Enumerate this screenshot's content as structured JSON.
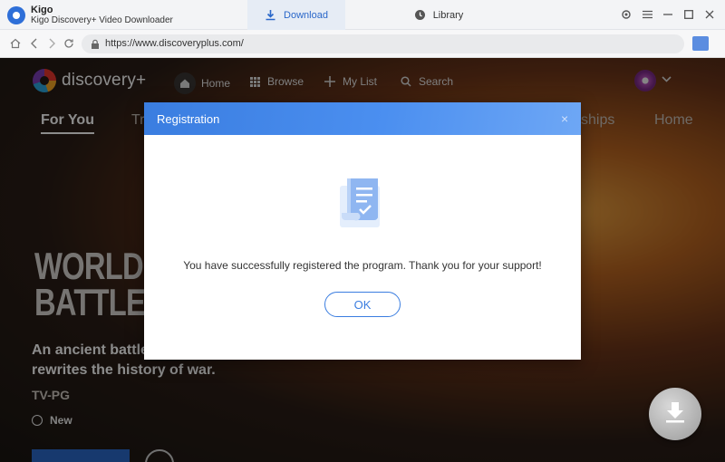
{
  "app": {
    "name": "Kigo",
    "subtitle": "Kigo Discovery+ Video Downloader"
  },
  "tabs": {
    "download": "Download",
    "library": "Library"
  },
  "address": {
    "url": "https://www.discoveryplus.com/"
  },
  "site": {
    "logo_text": "discovery+",
    "nav": {
      "home": "Home",
      "browse": "Browse",
      "mylist": "My List",
      "search": "Search"
    },
    "categories": {
      "for_you": "For You",
      "tr": "Tr",
      "ships": "ships",
      "home": "Home"
    },
    "hero_title": "WORLD'S FI\nBATTLEFI",
    "hero_desc": "An ancient battlef\nrewrites the history of war.",
    "rating": "TV-PG",
    "new_label": "New"
  },
  "modal": {
    "title": "Registration",
    "close": "×",
    "message": "You have successfully registered the program. Thank you for your support!",
    "ok": "OK"
  },
  "colors": {
    "accent": "#3a7de0",
    "tab_active_bg": "#e6ecf5"
  }
}
